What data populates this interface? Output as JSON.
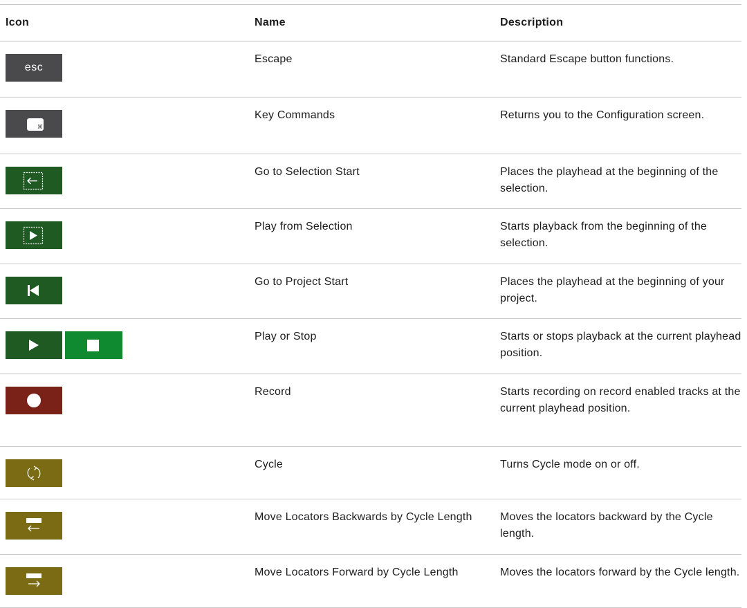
{
  "header": {
    "icon": "Icon",
    "name": "Name",
    "description": "Description"
  },
  "rows": [
    {
      "icons": [
        "esc-key"
      ],
      "esc_label": "esc",
      "name": "Escape",
      "description": "Standard Escape button functions."
    },
    {
      "icons": [
        "key-commands-icon"
      ],
      "name": "Key Commands",
      "description": "Returns you to the Configuration screen."
    },
    {
      "icons": [
        "go-to-selection-start-icon"
      ],
      "name": "Go to Selection Start",
      "description": "Places the playhead at the beginning of the selection."
    },
    {
      "icons": [
        "play-from-selection-icon"
      ],
      "name": "Play from Selection",
      "description": "Starts playback from the beginning of the selection."
    },
    {
      "icons": [
        "go-to-project-start-icon"
      ],
      "name": "Go to Project Start",
      "description": "Places the playhead at the beginning of your project."
    },
    {
      "icons": [
        "play-icon",
        "stop-icon"
      ],
      "name": "Play or Stop",
      "description": "Starts or stops playback at the current playhead position."
    },
    {
      "icons": [
        "record-icon"
      ],
      "name": "Record",
      "description": "Starts recording on record enabled tracks at the current playhead position."
    },
    {
      "icons": [
        "cycle-icon"
      ],
      "name": "Cycle",
      "description": "Turns Cycle mode on or off."
    },
    {
      "icons": [
        "move-locators-backward-icon"
      ],
      "name": "Move Locators Backwards by Cycle Length",
      "description": "Moves the locators backward by the Cycle length."
    },
    {
      "icons": [
        "move-locators-forward-icon"
      ],
      "name": "Move Locators Forward by Cycle Length",
      "description": "Moves the locators forward by the Cycle length."
    }
  ],
  "colors": {
    "gray": "#4a4a4c",
    "green": "#1f5a23",
    "bright_green": "#0f8a30",
    "red": "#7a2218",
    "olive": "#7b6b14",
    "rule": "#c8c8c8"
  }
}
